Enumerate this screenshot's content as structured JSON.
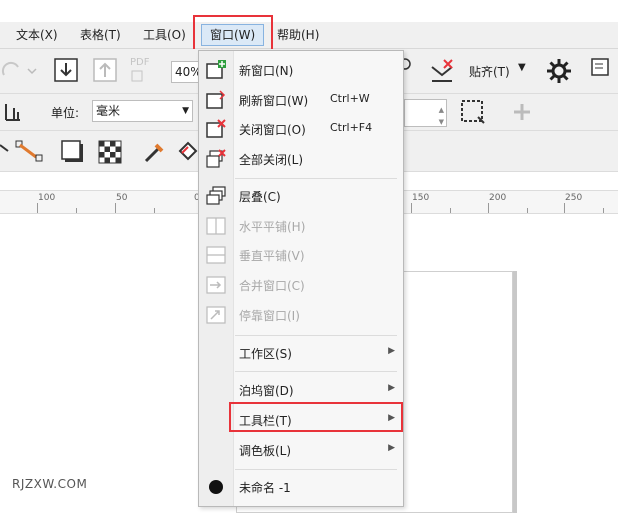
{
  "menubar": {
    "items": [
      {
        "label": "文本(X)"
      },
      {
        "label": "表格(T)"
      },
      {
        "label": "工具(O)"
      },
      {
        "label": "窗口(W)"
      },
      {
        "label": "帮助(H)"
      }
    ]
  },
  "toolbar": {
    "pdf_label": "PDF",
    "zoom_value": "40%",
    "snap_label": "贴齐(T)",
    "units_label": "单位:",
    "units_value": "毫米"
  },
  "ruler": {
    "ticks": [
      "100",
      "50",
      "0",
      "150",
      "200",
      "250"
    ]
  },
  "window_menu": {
    "items": [
      {
        "label": "新窗口(N)",
        "shortcut": ""
      },
      {
        "label": "刷新窗口(W)",
        "shortcut": "Ctrl+W"
      },
      {
        "label": "关闭窗口(O)",
        "shortcut": "Ctrl+F4"
      },
      {
        "label": "全部关闭(L)",
        "shortcut": ""
      },
      {
        "label": "层叠(C)"
      },
      {
        "label": "水平平铺(H)"
      },
      {
        "label": "垂直平铺(V)"
      },
      {
        "label": "合并窗口(C)"
      },
      {
        "label": "停靠窗口(I)"
      },
      {
        "label": "工作区(S)"
      },
      {
        "label": "泊坞窗(D)"
      },
      {
        "label": "工具栏(T)"
      },
      {
        "label": "调色板(L)"
      },
      {
        "label": "未命名 -1"
      }
    ]
  },
  "watermark": "RJZXW.COM",
  "colors": {
    "highlight": "#e8333a",
    "accent": "#2a7fd4"
  }
}
